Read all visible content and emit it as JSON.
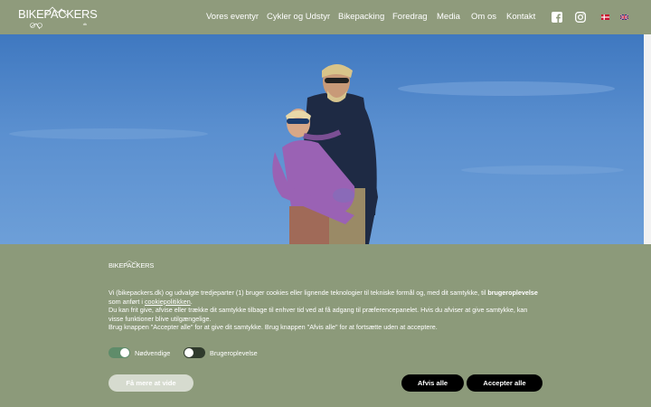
{
  "header": {
    "logo_text": "BIKEPACKERS",
    "logo_sub": "dk",
    "nav": [
      "Vores eventyr",
      "Cykler og Udstyr",
      "Bikepacking",
      "Foredrag",
      "Media",
      "Om os",
      "Kontakt"
    ]
  },
  "icons": {
    "facebook": "facebook-icon",
    "instagram": "instagram-icon",
    "flag_dk": "danish-flag-icon",
    "flag_en": "english-flag-icon"
  },
  "cookie": {
    "logo_text": "BIKEPACKERS",
    "line1_pre": "Vi (bikepackers.dk) og udvalgte tredjeparter (1) bruger cookies eller lignende teknologier til tekniske formål og, med dit samtykke, til ",
    "line1_bold": "brugeroplevelse",
    "line1_mid": " som anført i ",
    "line1_link": "cookiepolitikken",
    "line1_end": ".",
    "line2": "Du kan frit give, afvise eller trække dit samtykke tilbage til enhver tid ved at få adgang til præferencepanelet. Hvis du afviser at give samtykke, kan visse funktioner blive utilgængelige.",
    "line3": "Brug knappen \"Accepter alle\" for at give dit samtykke. Brug knappen \"Afvis alle\" for at fortsætte uden at acceptere.",
    "toggle_necessary": "Nødvendige",
    "toggle_experience": "Brugeroplevelse",
    "btn_more": "Få mere at vide",
    "btn_reject": "Afvis alle",
    "btn_accept": "Accepter alle"
  },
  "colors": {
    "header_bg": "#8f9b7c",
    "panel_bg": "#8c9a7a",
    "toggle_on": "#5f8c6a",
    "button_dark": "#000000"
  }
}
